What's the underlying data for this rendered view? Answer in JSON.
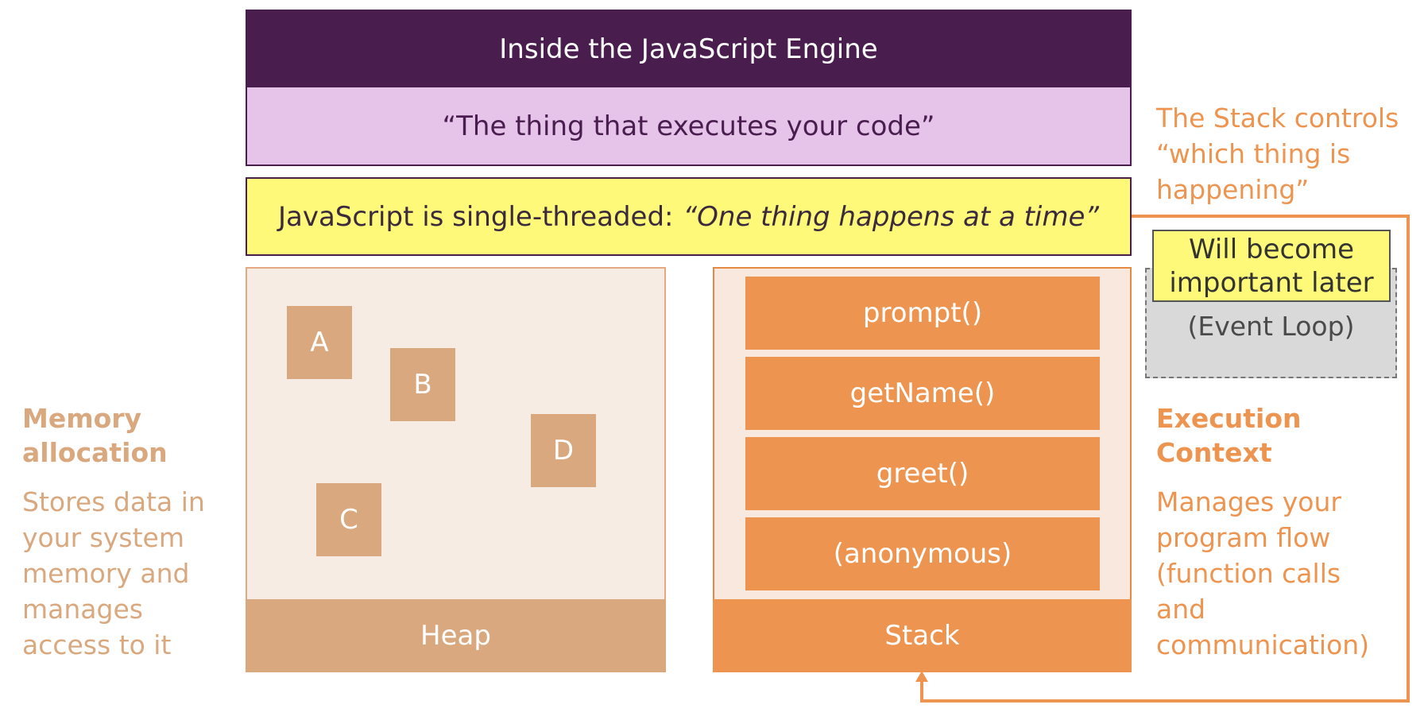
{
  "header": {
    "title": "Inside the JavaScript Engine",
    "subtitle": "“The thing that executes your code”",
    "single_thread_prefix": "JavaScript is single-threaded:",
    "single_thread_quote": "“One thing happens at a time”"
  },
  "heap": {
    "label": "Heap",
    "items": [
      "A",
      "B",
      "C",
      "D"
    ]
  },
  "stack": {
    "label": "Stack",
    "frames": [
      "prompt()",
      "getName()",
      "greet()",
      "(anonymous)"
    ]
  },
  "memory": {
    "heading": [
      "Memory",
      "allocation"
    ],
    "description": [
      "Stores data in",
      "your system",
      "memory and",
      "manages",
      "access to it"
    ]
  },
  "execution": {
    "heading": [
      "Execution",
      "Context"
    ],
    "description": [
      "Manages your",
      "program flow",
      "(function calls",
      "and",
      "communication)"
    ]
  },
  "stack_note": [
    "The Stack controls",
    "“which thing is",
    "happening”"
  ],
  "event_loop": {
    "label": "(Event Loop)",
    "note": [
      "Will become",
      "important later"
    ]
  },
  "colors": {
    "purple": "#4a1d4f",
    "lilac": "#e6c4ea",
    "yellow": "#fff97a",
    "heap_tan": "#d9a87e",
    "stack_orange": "#ed9550"
  }
}
